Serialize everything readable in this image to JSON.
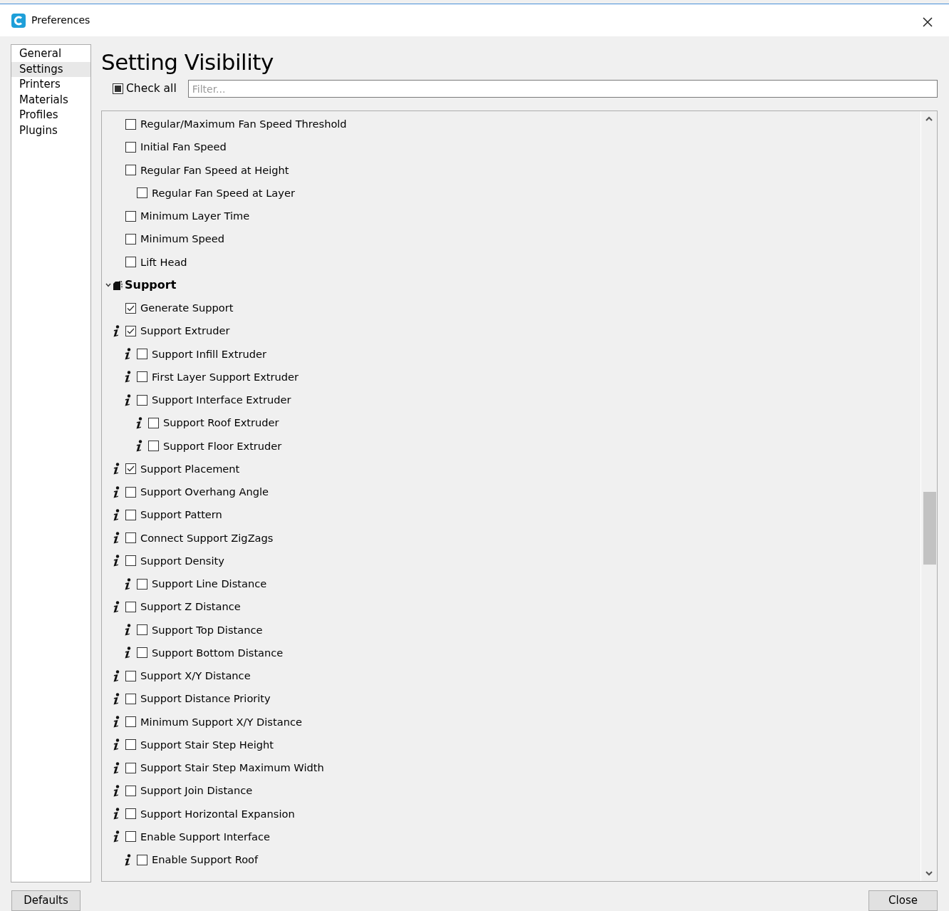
{
  "window": {
    "title": "Preferences"
  },
  "sidebar": {
    "items": [
      {
        "label": "General",
        "selected": false
      },
      {
        "label": "Settings",
        "selected": true
      },
      {
        "label": "Printers",
        "selected": false
      },
      {
        "label": "Materials",
        "selected": false
      },
      {
        "label": "Profiles",
        "selected": false
      },
      {
        "label": "Plugins",
        "selected": false
      }
    ]
  },
  "heading": "Setting Visibility",
  "check_all": {
    "label": "Check all",
    "indeterminate": true
  },
  "filter": {
    "placeholder": "Filter..."
  },
  "settings": [
    {
      "kind": "setting",
      "label": "Regular/Maximum Fan Speed Threshold",
      "checked": false,
      "info": false
    },
    {
      "kind": "setting",
      "label": "Initial Fan Speed",
      "checked": false,
      "info": false
    },
    {
      "kind": "setting",
      "label": "Regular Fan Speed at Height",
      "checked": false,
      "info": false,
      "children": [
        {
          "kind": "setting",
          "label": "Regular Fan Speed at Layer",
          "checked": false,
          "info": false
        }
      ]
    },
    {
      "kind": "setting",
      "label": "Minimum Layer Time",
      "checked": false,
      "info": false
    },
    {
      "kind": "setting",
      "label": "Minimum Speed",
      "checked": false,
      "info": false
    },
    {
      "kind": "setting",
      "label": "Lift Head",
      "checked": false,
      "info": false
    },
    {
      "kind": "category",
      "label": "Support",
      "expanded": true,
      "children": [
        {
          "kind": "setting",
          "label": "Generate Support",
          "checked": true,
          "info": false
        },
        {
          "kind": "setting",
          "label": "Support Extruder",
          "checked": true,
          "info": true,
          "children": [
            {
              "kind": "setting",
              "label": "Support Infill Extruder",
              "checked": false,
              "info": true
            },
            {
              "kind": "setting",
              "label": "First Layer Support Extruder",
              "checked": false,
              "info": true
            },
            {
              "kind": "setting",
              "label": "Support Interface Extruder",
              "checked": false,
              "info": true,
              "children": [
                {
                  "kind": "setting",
                  "label": "Support Roof Extruder",
                  "checked": false,
                  "info": true
                },
                {
                  "kind": "setting",
                  "label": "Support Floor Extruder",
                  "checked": false,
                  "info": true
                }
              ]
            }
          ]
        },
        {
          "kind": "setting",
          "label": "Support Placement",
          "checked": true,
          "info": true
        },
        {
          "kind": "setting",
          "label": "Support Overhang Angle",
          "checked": false,
          "info": true
        },
        {
          "kind": "setting",
          "label": "Support Pattern",
          "checked": false,
          "info": true
        },
        {
          "kind": "setting",
          "label": "Connect Support ZigZags",
          "checked": false,
          "info": true
        },
        {
          "kind": "setting",
          "label": "Support Density",
          "checked": false,
          "info": true,
          "children": [
            {
              "kind": "setting",
              "label": "Support Line Distance",
              "checked": false,
              "info": true
            }
          ]
        },
        {
          "kind": "setting",
          "label": "Support Z Distance",
          "checked": false,
          "info": true,
          "children": [
            {
              "kind": "setting",
              "label": "Support Top Distance",
              "checked": false,
              "info": true
            },
            {
              "kind": "setting",
              "label": "Support Bottom Distance",
              "checked": false,
              "info": true
            }
          ]
        },
        {
          "kind": "setting",
          "label": "Support X/Y Distance",
          "checked": false,
          "info": true
        },
        {
          "kind": "setting",
          "label": "Support Distance Priority",
          "checked": false,
          "info": true
        },
        {
          "kind": "setting",
          "label": "Minimum Support X/Y Distance",
          "checked": false,
          "info": true
        },
        {
          "kind": "setting",
          "label": "Support Stair Step Height",
          "checked": false,
          "info": true
        },
        {
          "kind": "setting",
          "label": "Support Stair Step Maximum Width",
          "checked": false,
          "info": true
        },
        {
          "kind": "setting",
          "label": "Support Join Distance",
          "checked": false,
          "info": true
        },
        {
          "kind": "setting",
          "label": "Support Horizontal Expansion",
          "checked": false,
          "info": true
        },
        {
          "kind": "setting",
          "label": "Enable Support Interface",
          "checked": false,
          "info": true,
          "children": [
            {
              "kind": "setting",
              "label": "Enable Support Roof",
              "checked": false,
              "info": true
            }
          ]
        }
      ]
    }
  ],
  "buttons": {
    "left": "Defaults",
    "right": "Close"
  }
}
